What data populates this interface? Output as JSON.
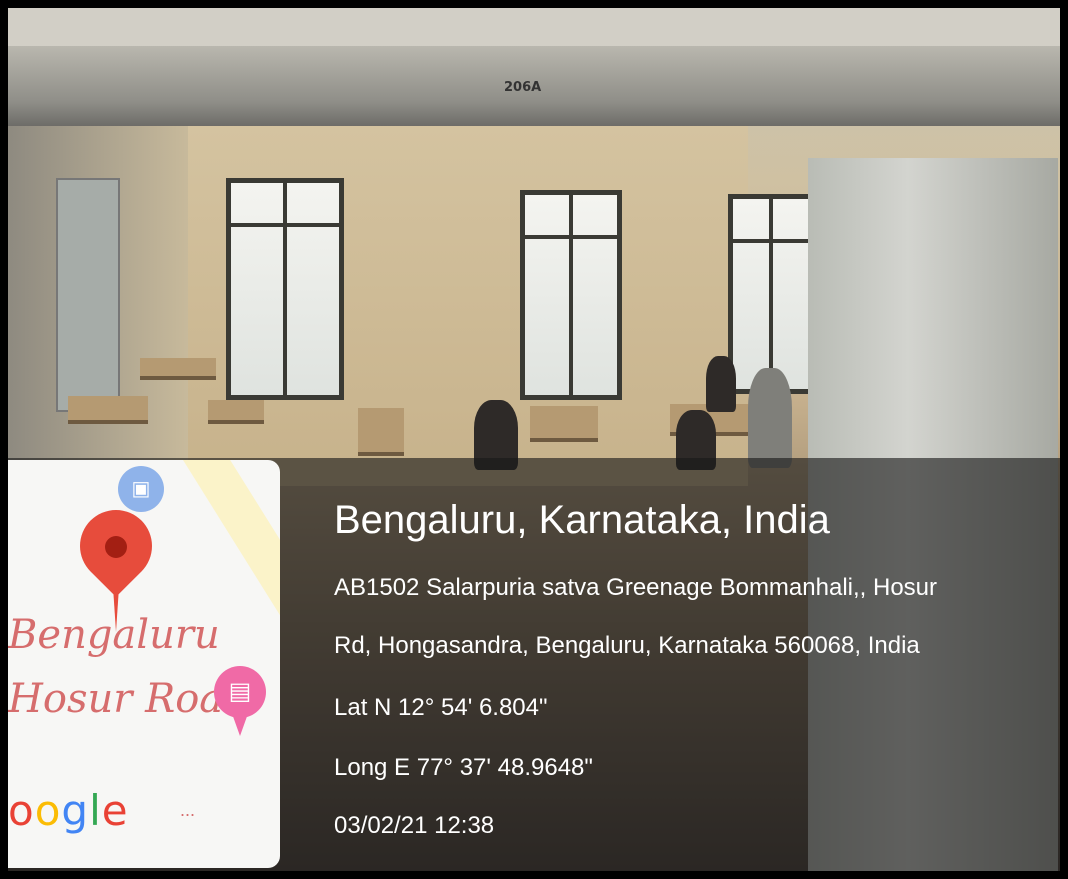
{
  "photo": {
    "room_number": "206A"
  },
  "map": {
    "area_line1": "Bengaluru",
    "area_line2": "Hosur Road",
    "logo_text": "oogle",
    "more": "...",
    "icons": [
      "bus-stop-icon",
      "location-pin-icon",
      "hotel-icon"
    ]
  },
  "location": {
    "city": "Bengaluru, Karnataka, India",
    "address_line1": "AB1502 Salarpuria satva Greenage Bommanhali,, Hosur",
    "address_line2": "Rd, Hongasandra, Bengaluru, Karnataka 560068, India",
    "latitude": "Lat N 12° 54' 6.804\"",
    "longitude": "Long E 77° 37' 48.9648\"",
    "datetime": "03/02/21 12:38"
  },
  "colors": {
    "pin": "#e74c3c",
    "hotel": "#f06aa6",
    "bus": "#8fb3ea",
    "overlay_text": "#ffffff"
  }
}
